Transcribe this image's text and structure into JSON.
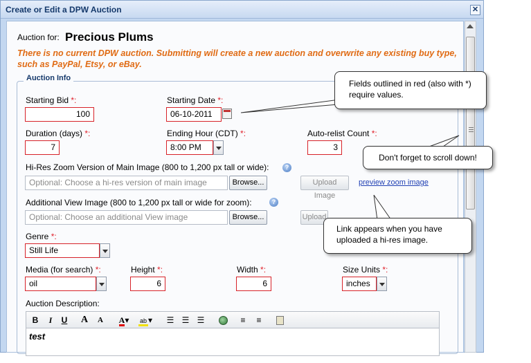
{
  "dialog": {
    "title": "Create or Edit a DPW Auction",
    "close_glyph": "✕"
  },
  "header": {
    "auction_for_label": "Auction for:",
    "painting_name": "Precious Plums",
    "warning": "There is no current DPW auction. Submitting will create a new auction and overwrite any existing buy type, such as PayPal, Etsy, or eBay."
  },
  "fieldset_legend": "Auction Info",
  "fields": {
    "starting_bid": {
      "label": "Starting Bid",
      "value": "100"
    },
    "starting_date": {
      "label": "Starting Date",
      "value": "06-10-2011"
    },
    "duration": {
      "label": "Duration (days)",
      "value": "7"
    },
    "ending_hour": {
      "label": "Ending Hour (CDT)",
      "value": "8:00 PM"
    },
    "auto_relist": {
      "label": "Auto-relist Count",
      "value": "3"
    },
    "hires_image": {
      "label": "Hi-Res Zoom Version of Main Image (800 to 1,200 px tall or wide):",
      "placeholder": "Optional: Choose a hi-res version of main image"
    },
    "additional_image": {
      "label": "Additional View Image (800 to 1,200 px tall or wide for zoom):",
      "placeholder": "Optional: Choose an additional View image"
    },
    "genre": {
      "label": "Genre",
      "value": "Still Life"
    },
    "media": {
      "label": "Media (for search)",
      "value": "oil"
    },
    "height": {
      "label": "Height",
      "value": "6"
    },
    "width": {
      "label": "Width",
      "value": "6"
    },
    "size_units": {
      "label": "Size Units",
      "value": "inches"
    },
    "description": {
      "label": "Auction Description:",
      "value": "test"
    }
  },
  "required_mark": "*:",
  "colon": ":",
  "buttons": {
    "browse": "Browse...",
    "upload_image": "Upload Image",
    "upload_partial": "Upload I",
    "preview_zoom": "preview zoom image"
  },
  "toolbar": {
    "bold": "B",
    "italic": "I",
    "underline": "U",
    "font_size_up": "A",
    "font_size_down": "A"
  },
  "callouts": {
    "required": "Fields outlined in red (also with *) require values.",
    "scroll": "Don't forget to scroll down!",
    "link": "Link appears when you have uploaded a hi-res image."
  },
  "colors": {
    "required_border": "#d72128",
    "warning_text": "#e06b14",
    "link": "#1f3fb3",
    "title_text": "#15396b"
  },
  "icons": [
    "calendar-icon",
    "help-icon",
    "dropdown-arrow-icon",
    "font-color-icon",
    "highlight-icon",
    "align-left-icon",
    "align-center-icon",
    "align-right-icon",
    "image-icon",
    "ordered-list-icon",
    "unordered-list-icon",
    "paste-icon",
    "close-icon"
  ]
}
